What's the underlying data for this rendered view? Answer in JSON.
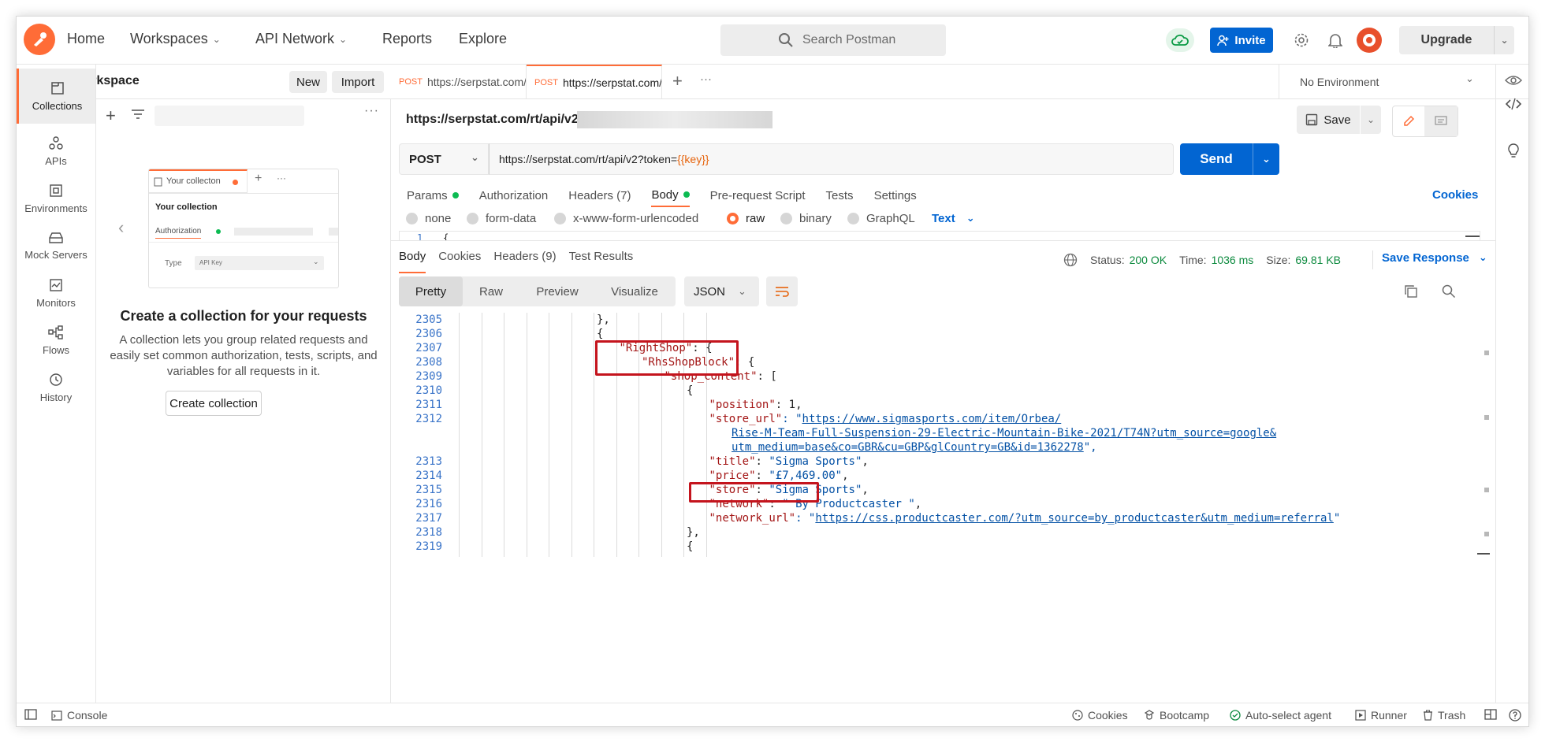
{
  "header": {
    "nav": [
      {
        "label": "Home",
        "has_menu": false
      },
      {
        "label": "Workspaces",
        "has_menu": true
      },
      {
        "label": "API Network",
        "has_menu": true
      },
      {
        "label": "Reports",
        "has_menu": false
      },
      {
        "label": "Explore",
        "has_menu": false
      }
    ],
    "search_placeholder": "Search Postman",
    "invite_label": "Invite",
    "upgrade_label": "Upgrade",
    "brand_color": "#ff6c37",
    "accent_color": "#0265d2"
  },
  "workspace": {
    "title": "My Workspace",
    "new_label": "New",
    "import_label": "Import"
  },
  "rail": [
    {
      "label": "Collections",
      "icon": "collections-icon",
      "active": true
    },
    {
      "label": "APIs",
      "icon": "apis-icon",
      "active": false
    },
    {
      "label": "Environments",
      "icon": "environments-icon",
      "active": false
    },
    {
      "label": "Mock Servers",
      "icon": "mock-servers-icon",
      "active": false
    },
    {
      "label": "Monitors",
      "icon": "monitors-icon",
      "active": false
    },
    {
      "label": "Flows",
      "icon": "flows-icon",
      "active": false
    },
    {
      "label": "History",
      "icon": "history-icon",
      "active": false
    }
  ],
  "empty_state": {
    "preview_tab": "Your collecton",
    "preview_title": "Your collection",
    "preview_auth": "Authorization",
    "preview_type_label": "Type",
    "preview_type_value": "API Key",
    "title": "Create a collection for your requests",
    "description": "A collection lets you group related requests and easily set common authorization, tests, scripts, and variables for all requests in it.",
    "button": "Create collection"
  },
  "tabs": [
    {
      "method": "POST",
      "label": "https://serpstat.com/r",
      "active": false
    },
    {
      "method": "POST",
      "label": "https://serpstat.com/r",
      "active": true
    }
  ],
  "environment": "No Environment",
  "request": {
    "title": "https://serpstat.com/rt/api/v2?token=",
    "save_label": "Save",
    "method": "POST",
    "url_base": "https://serpstat.com/rt/api/v2?token=",
    "url_var": "{{key}}",
    "send_label": "Send",
    "subtabs": [
      {
        "label": "Params",
        "dot": "green",
        "active": false
      },
      {
        "label": "Authorization",
        "dot": "",
        "active": false
      },
      {
        "label": "Headers (7)",
        "dot": "",
        "active": false
      },
      {
        "label": "Body",
        "dot": "green",
        "active": true
      },
      {
        "label": "Pre-request Script",
        "dot": "",
        "active": false
      },
      {
        "label": "Tests",
        "dot": "",
        "active": false
      },
      {
        "label": "Settings",
        "dot": "",
        "active": false
      }
    ],
    "cookies_label": "Cookies",
    "body_types": [
      {
        "label": "none",
        "selected": false
      },
      {
        "label": "form-data",
        "selected": false
      },
      {
        "label": "x-www-form-urlencoded",
        "selected": false
      },
      {
        "label": "raw",
        "selected": true
      },
      {
        "label": "binary",
        "selected": false
      },
      {
        "label": "GraphQL",
        "selected": false
      }
    ],
    "raw_format": "Text",
    "body_first_line_no": "1",
    "body_first_line": "{"
  },
  "response": {
    "tabs": [
      {
        "label": "Body",
        "active": true
      },
      {
        "label": "Cookies",
        "active": false
      },
      {
        "label": "Headers (9)",
        "active": false
      },
      {
        "label": "Test Results",
        "active": false
      }
    ],
    "status_label": "Status:",
    "status": "200 OK",
    "time_label": "Time:",
    "time": "1036 ms",
    "size_label": "Size:",
    "size": "69.81 KB",
    "save_label": "Save Response",
    "views": [
      {
        "label": "Pretty",
        "active": true
      },
      {
        "label": "Raw",
        "active": false
      },
      {
        "label": "Preview",
        "active": false
      },
      {
        "label": "Visualize",
        "active": false
      }
    ],
    "format": "JSON",
    "lines": [
      {
        "no": "2305",
        "indent": 6,
        "segments": [
          {
            "t": "},",
            "c": "p"
          }
        ]
      },
      {
        "no": "2306",
        "indent": 6,
        "segments": [
          {
            "t": "{",
            "c": "p"
          }
        ]
      },
      {
        "no": "2307",
        "indent": 7,
        "segments": [
          {
            "t": "\"RightShop\"",
            "c": "k"
          },
          {
            "t": ": {",
            "c": "p"
          }
        ]
      },
      {
        "no": "2308",
        "indent": 8,
        "segments": [
          {
            "t": "\"RhsShopBlock\"",
            "c": "k"
          },
          {
            "t": ": {",
            "c": "p"
          }
        ]
      },
      {
        "no": "2309",
        "indent": 9,
        "segments": [
          {
            "t": "\"shop_content\"",
            "c": "k"
          },
          {
            "t": ": [",
            "c": "p"
          }
        ]
      },
      {
        "no": "2310",
        "indent": 10,
        "segments": [
          {
            "t": "{",
            "c": "p"
          }
        ]
      },
      {
        "no": "2311",
        "indent": 11,
        "segments": [
          {
            "t": "\"position\"",
            "c": "k"
          },
          {
            "t": ": 1,",
            "c": "p"
          }
        ]
      },
      {
        "no": "2312",
        "indent": 11,
        "segments": [
          {
            "t": "\"store_url\"",
            "c": "k"
          },
          {
            "t": ": \"",
            "c": "s"
          },
          {
            "t": "https://www.sigmasports.com/item/Orbea/",
            "c": "l"
          }
        ]
      },
      {
        "no": "",
        "indent": 12,
        "segments": [
          {
            "t": "Rise-M-Team-Full-Suspension-29-Electric-Mountain-Bike-2021/T74N?utm_source=google&",
            "c": "l"
          }
        ]
      },
      {
        "no": "",
        "indent": 12,
        "segments": [
          {
            "t": "utm_medium=base&co=GBR&cu=GBP&glCountry=GB&id=1362278",
            "c": "l"
          },
          {
            "t": "\",",
            "c": "s"
          }
        ]
      },
      {
        "no": "2313",
        "indent": 11,
        "segments": [
          {
            "t": "\"title\"",
            "c": "k"
          },
          {
            "t": ": ",
            "c": "p"
          },
          {
            "t": "\"Sigma Sports\"",
            "c": "s"
          },
          {
            "t": ",",
            "c": "p"
          }
        ]
      },
      {
        "no": "2314",
        "indent": 11,
        "segments": [
          {
            "t": "\"price\"",
            "c": "k"
          },
          {
            "t": ": ",
            "c": "p"
          },
          {
            "t": "\"£7,469.00\"",
            "c": "s"
          },
          {
            "t": ",",
            "c": "p"
          }
        ]
      },
      {
        "no": "2315",
        "indent": 11,
        "segments": [
          {
            "t": "\"store\"",
            "c": "k"
          },
          {
            "t": ": ",
            "c": "p"
          },
          {
            "t": "\"Sigma Sports\"",
            "c": "s"
          },
          {
            "t": ",",
            "c": "p"
          }
        ]
      },
      {
        "no": "2316",
        "indent": 11,
        "segments": [
          {
            "t": "\"network\"",
            "c": "k"
          },
          {
            "t": ": ",
            "c": "p"
          },
          {
            "t": "\" By Productcaster \"",
            "c": "s"
          },
          {
            "t": ",",
            "c": "p"
          }
        ]
      },
      {
        "no": "2317",
        "indent": 11,
        "segments": [
          {
            "t": "\"network_url\"",
            "c": "k"
          },
          {
            "t": ": \"",
            "c": "s"
          },
          {
            "t": "https://css.productcaster.com/?utm_source=by_productcaster&utm_medium=referral",
            "c": "l"
          },
          {
            "t": "\"",
            "c": "s"
          }
        ]
      },
      {
        "no": "2318",
        "indent": 10,
        "segments": [
          {
            "t": "},",
            "c": "p"
          }
        ]
      },
      {
        "no": "2319",
        "indent": 10,
        "segments": [
          {
            "t": "{",
            "c": "p"
          }
        ]
      }
    ]
  },
  "statusbar": {
    "console": "Console",
    "cookies": "Cookies",
    "bootcamp": "Bootcamp",
    "agent": "Auto-select agent",
    "runner": "Runner",
    "trash": "Trash"
  }
}
